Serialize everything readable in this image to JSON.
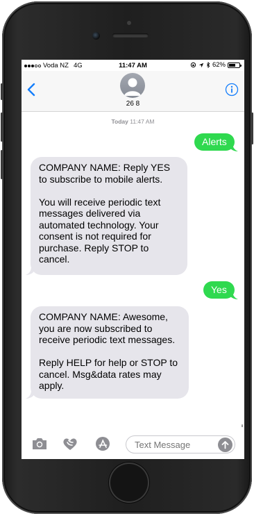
{
  "status_bar": {
    "carrier": "Voda NZ",
    "network": "4G",
    "time": "11:47 AM",
    "battery_percent": "62%",
    "battery_level": 0.62
  },
  "nav": {
    "contact_name": "26 8"
  },
  "conversation": {
    "timestamp_day": "Today",
    "timestamp_time": "11:47 AM",
    "messages": [
      {
        "direction": "outgoing",
        "text": "Alerts"
      },
      {
        "direction": "incoming",
        "text": "COMPANY NAME: Reply YES to subscribe to mobile alerts.\n\nYou will receive periodic text messages delivered via automated technology. Your consent is not required for purchase. Reply STOP to cancel."
      },
      {
        "direction": "outgoing",
        "text": "Yes"
      },
      {
        "direction": "incoming",
        "text": "COMPANY NAME: Awesome, you are now subscribed to receive periodic text messages.\n\nReply HELP for help or STOP to cancel. Msg&data rates may apply."
      }
    ]
  },
  "composer": {
    "placeholder": "Text Message",
    "value": ""
  },
  "icons": {
    "back": "chevron-left-icon",
    "info": "info-icon",
    "camera": "camera-icon",
    "digital_touch": "heart-hands-icon",
    "app_store": "app-store-icon",
    "send": "arrow-up-icon"
  },
  "colors": {
    "outgoing_bubble": "#2fd94f",
    "incoming_bubble": "#e6e5eb",
    "ios_blue": "#147efb",
    "gray": "#8e8e93"
  }
}
